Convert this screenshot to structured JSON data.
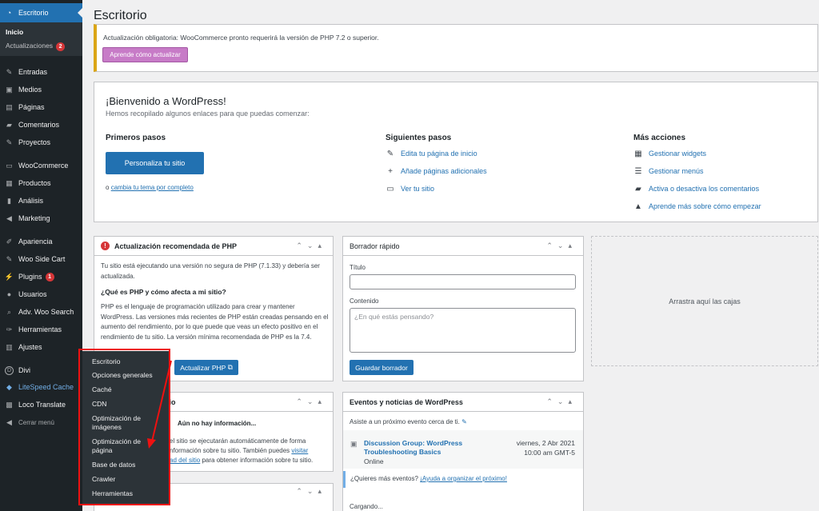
{
  "sidebar": {
    "active": "Escritorio",
    "sub_items": [
      "Inicio",
      "Actualizaciones"
    ],
    "updates_count": "2",
    "items": [
      {
        "label": "Entradas",
        "icon": "pin-icon"
      },
      {
        "label": "Medios",
        "icon": "media-icon"
      },
      {
        "label": "Páginas",
        "icon": "pages-icon"
      },
      {
        "label": "Comentarios",
        "icon": "comments-icon"
      },
      {
        "label": "Proyectos",
        "icon": "pin-icon"
      },
      {
        "label": "WooCommerce",
        "icon": "woo-icon"
      },
      {
        "label": "Productos",
        "icon": "products-icon"
      },
      {
        "label": "Análisis",
        "icon": "chart-icon"
      },
      {
        "label": "Marketing",
        "icon": "megaphone-icon"
      },
      {
        "label": "Apariencia",
        "icon": "brush-icon"
      },
      {
        "label": "Woo Side Cart",
        "icon": "pin-icon"
      },
      {
        "label": "Plugins",
        "icon": "plug-icon"
      },
      {
        "label": "Usuarios",
        "icon": "user-icon"
      },
      {
        "label": "Adv. Woo Search",
        "icon": "search-icon"
      },
      {
        "label": "Herramientas",
        "icon": "wrench-icon"
      },
      {
        "label": "Ajustes",
        "icon": "settings-icon"
      },
      {
        "label": "Divi",
        "icon": "divi-icon"
      },
      {
        "label": "LiteSpeed Cache",
        "icon": "diamond-icon"
      },
      {
        "label": "Loco Translate",
        "icon": "translate-icon"
      },
      {
        "label": "Cerrar menú",
        "icon": "collapse-icon"
      }
    ],
    "plugins_count": "1"
  },
  "flyout": [
    "Escritorio",
    "Opciones generales",
    "Caché",
    "CDN",
    "Optimización de imágenes",
    "Optimización de página",
    "Base de datos",
    "Crawler",
    "Herramientas"
  ],
  "page_title": "Escritorio",
  "notice": {
    "text": "Actualización obligatoria: WooCommerce pronto requerirá la versión de PHP 7.2 o superior.",
    "button": "Aprende cómo actualizar"
  },
  "welcome": {
    "title": "¡Bienvenido a WordPress!",
    "subtitle": "Hemos recopilado algunos enlaces para que puedas comenzar:",
    "col1_title": "Primeros pasos",
    "customize_button": "Personaliza tu sitio",
    "alt_prefix": "o",
    "alt_link": "cambia tu tema por completo",
    "col2_title": "Siguientes pasos",
    "next_steps": [
      "Edita tu página de inicio",
      "Añade páginas adicionales",
      "Ver tu sitio"
    ],
    "col3_title": "Más acciones",
    "more_actions": [
      "Gestionar widgets",
      "Gestionar menús",
      "Activa o desactiva los comentarios",
      "Aprende más sobre cómo empezar"
    ]
  },
  "php_box": {
    "title": "Actualización recomendada de PHP",
    "p1": "Tu sitio está ejecutando una versión no segura de PHP (7.1.33) y debería ser actualizada.",
    "q": "¿Qué es PHP y cómo afecta a mi sitio?",
    "p2": "PHP es el lenguaje de programación utilizado para crear y mantener WordPress. Las versiones más recientes de PHP están creadas pensando en el aumento del rendimiento, por lo que puede que veas un efecto positivo en el rendimiento de tu sitio. La versión mínima recomendada de PHP es la 7.4.",
    "button": "Actualizar PHP"
  },
  "health_box": {
    "title_tail": "itio",
    "no_info": "Aún no hay información...",
    "text_l1": "el sitio se ejecutarán automáticamente de forma",
    "text_l2": "nformación sobre tu sitio. También puedes",
    "link1": "visitar",
    "text_l3_link": "ad del sitio",
    "text_l3": "para obtener información sobre tu sitio."
  },
  "draft": {
    "title": "Borrador rápido",
    "title_label": "Título",
    "content_label": "Contenido",
    "content_placeholder": "¿En qué estás pensando?",
    "save_button": "Guardar borrador"
  },
  "events": {
    "title": "Eventos y noticias de WordPress",
    "attend": "Asiste a un próximo evento cerca de ti.",
    "event_title": "Discussion Group: WordPress Troubleshooting Basics",
    "event_place": "Online",
    "event_date": "viernes, 2 Abr 2021",
    "event_time": "10:00 am GMT-5",
    "more_q": "¿Quieres más eventos?",
    "more_link": "¡Ayuda a organizar el próximo!",
    "loading": "Cargando..."
  },
  "dropzone": "Arrastra aquí las cajas"
}
